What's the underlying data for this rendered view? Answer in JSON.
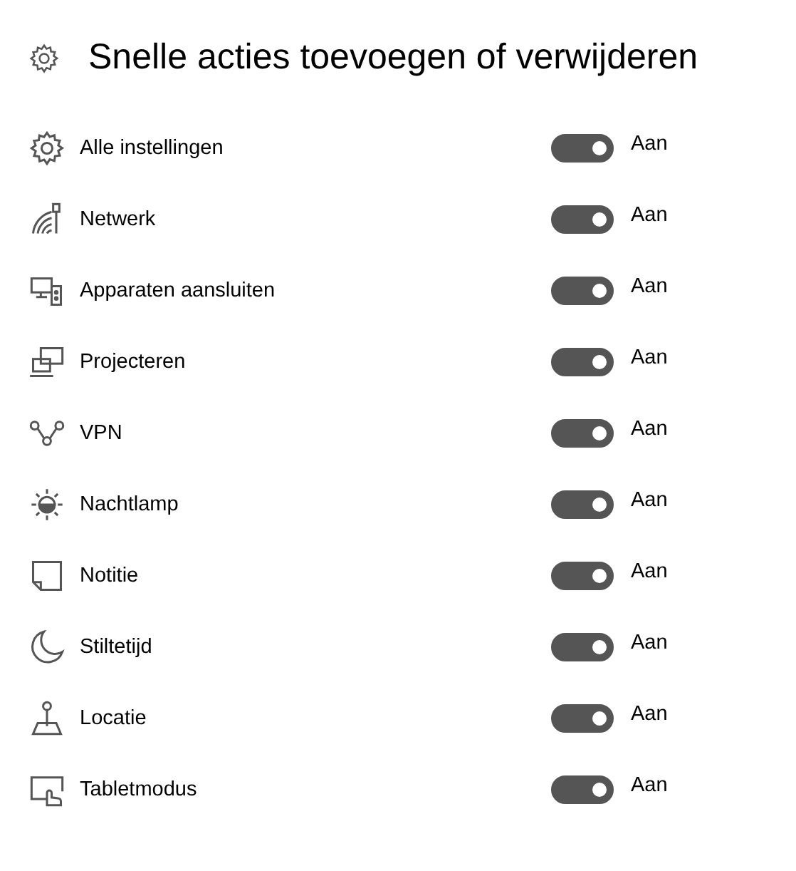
{
  "title": "Snelle acties toevoegen of verwijderen",
  "items": [
    {
      "label": "Alle instellingen",
      "on": true,
      "state_label": "Aan"
    },
    {
      "label": "Netwerk",
      "on": true,
      "state_label": "Aan"
    },
    {
      "label": "Apparaten aansluiten",
      "on": true,
      "state_label": "Aan"
    },
    {
      "label": "Projecteren",
      "on": true,
      "state_label": "Aan"
    },
    {
      "label": "VPN",
      "on": true,
      "state_label": "Aan"
    },
    {
      "label": "Nachtlamp",
      "on": true,
      "state_label": "Aan"
    },
    {
      "label": "Notitie",
      "on": true,
      "state_label": "Aan"
    },
    {
      "label": "Stiltetijd",
      "on": true,
      "state_label": "Aan"
    },
    {
      "label": "Locatie",
      "on": true,
      "state_label": "Aan"
    },
    {
      "label": "Tabletmodus",
      "on": true,
      "state_label": "Aan"
    }
  ]
}
